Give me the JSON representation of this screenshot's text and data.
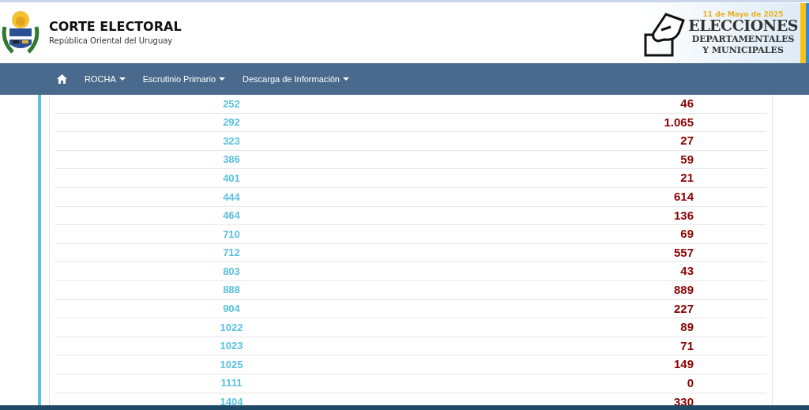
{
  "header": {
    "title": "CORTE ELECTORAL",
    "subtitle": "República Oriental del Uruguay",
    "banner": {
      "date": "11 de Mayo de 2025",
      "line_1": "ELECCIONES",
      "line_2": "DEPARTAMENTALES",
      "line_3": "Y MUNICIPALES"
    }
  },
  "nav": {
    "items": [
      {
        "label": "ROCHA",
        "kind": "dropdown"
      },
      {
        "label": "Escrutinio Primario",
        "kind": "dropdown"
      },
      {
        "label": "Descarga de Información",
        "kind": "dropdown"
      }
    ]
  },
  "table": {
    "rows": [
      {
        "lista": "252",
        "votos": "46"
      },
      {
        "lista": "292",
        "votos": "1.065"
      },
      {
        "lista": "323",
        "votos": "27"
      },
      {
        "lista": "386",
        "votos": "59"
      },
      {
        "lista": "401",
        "votos": "21"
      },
      {
        "lista": "444",
        "votos": "614"
      },
      {
        "lista": "464",
        "votos": "136"
      },
      {
        "lista": "710",
        "votos": "69"
      },
      {
        "lista": "712",
        "votos": "557"
      },
      {
        "lista": "803",
        "votos": "43"
      },
      {
        "lista": "888",
        "votos": "889"
      },
      {
        "lista": "904",
        "votos": "227"
      },
      {
        "lista": "1022",
        "votos": "89"
      },
      {
        "lista": "1023",
        "votos": "71"
      },
      {
        "lista": "1025",
        "votos": "149"
      },
      {
        "lista": "1111",
        "votos": "0"
      },
      {
        "lista": "1404",
        "votos": "330"
      }
    ]
  }
}
